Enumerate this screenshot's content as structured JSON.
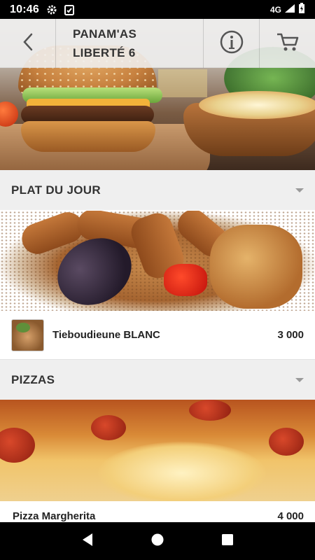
{
  "status_bar": {
    "time": "10:46",
    "network": "4G",
    "icons": [
      "gear-icon",
      "checklist-icon",
      "signal-icon",
      "battery-icon"
    ]
  },
  "header": {
    "title_line1": "PANAM'AS",
    "title_line2": "LIBERTÉ 6",
    "back_icon": "chevron-left-icon",
    "info_icon": "info-circle-icon",
    "cart_icon": "cart-icon"
  },
  "sections": [
    {
      "title": "PLAT DU JOUR",
      "items": [
        {
          "name": "Tieboudieune BLANC",
          "price": "3 000"
        }
      ]
    },
    {
      "title": "PIZZAS",
      "items": [
        {
          "name": "Pizza Margherita",
          "price": "4 000"
        }
      ]
    }
  ],
  "colors": {
    "header_bg": "#f0f0f0",
    "section_bg": "#efefef",
    "text": "#333333",
    "status_bar": "#000000"
  }
}
